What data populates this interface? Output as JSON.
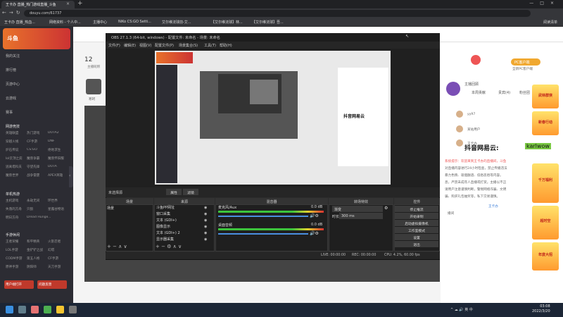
{
  "browser": {
    "tab_title": "王卡办 直播_热门游戏直播_斗鱼",
    "url": "douyu.com/61737",
    "bookmarks": [
      "王卡办 直播_热血...",
      "网络资料 - 个人中...",
      "主播中心",
      "NiKo CS:GO Setti...",
      "艾尔维法球前-艾...",
      "【艾尔维法球】林...",
      "【艾尔维法球】吾..."
    ],
    "right_label": "阅读清单"
  },
  "site": {
    "logo_text": "斗鱼",
    "header_count": "12",
    "header_count_label": "主播昵称",
    "streamer_name": "寒珂",
    "nav": [
      "我的关注",
      "排行榜",
      "页游中心",
      "云游戏",
      "赛事",
      "...",
      "..."
    ],
    "sections": [
      {
        "title": "网游竞技",
        "items": [
          "英雄联盟",
          "热门游戏",
          "DOTA2",
          "穿越火线",
          "CF手游",
          "DNF",
          "炉石传说",
          "CS:GO",
          "绝地求生",
          "lol云顶之弈",
          "魔兽争霸",
          "魔兽怀旧服",
          "逃离塔科夫",
          "守望先锋",
          "DOTA",
          "魔兽世界",
          "战争雷霆",
          "APEX英雄"
        ]
      },
      {
        "title": "单机热游",
        "items": [
          "主机游戏",
          "永劫无间",
          "环世界",
          "失落的方舟",
          "只狼",
          "星露谷物语",
          "明日方舟",
          "Dread Hunger",
          "..."
        ]
      },
      {
        "title": "手游休闲",
        "items": [
          "王者荣耀",
          "和平精英",
          "火影忍者",
          "LOL手游",
          "金铲铲之战",
          "幻塔",
          "CODM手游",
          "第五人格",
          "CF手游",
          "原神手游",
          "阴阳师",
          "天刀手游"
        ]
      }
    ],
    "sidebar_btn1": "用户端打开",
    "sidebar_btn2": "问题反馈"
  },
  "obs": {
    "title": "OBS 27.1.3 (64-bit, windows) - 配置文件: 未命名 - 场景: 未命名",
    "menu": [
      "文件(F)",
      "编辑(E)",
      "视图(V)",
      "配置文件(P)",
      "场景集合(S)",
      "工具(T)",
      "帮助(H)"
    ],
    "source_selected": "未选择源",
    "mode_btns": [
      "属性",
      "滤镜"
    ],
    "docks": {
      "scenes": "场景",
      "sources": "来源",
      "mixer": "混音器",
      "transitions": "转场特效",
      "controls": "控件"
    },
    "scene_items": [
      "场景"
    ],
    "source_items": [
      "斗鱼PP网址",
      "窗口采集",
      "文本 (GDI+)",
      "图像显示",
      "文本 (GDI+) 2",
      "显示器采集"
    ],
    "mixer": [
      {
        "name": "麦克风/Aux",
        "db": "0.0 dB"
      },
      {
        "name": "桌面音频",
        "db": "0.0 dB"
      }
    ],
    "transition": {
      "type": "渐变",
      "duration_label": "时长",
      "duration": "300 ms"
    },
    "controls": [
      "停止推流",
      "开始录制",
      "启动虚拟摄像机",
      "工作室模式",
      "设置",
      "退出"
    ],
    "status": {
      "live": "LIVE: 00:00:00",
      "rec": "REC: 00:00:00",
      "cpu": "CPU: 4.2%, 60.00 fps"
    }
  },
  "watermark": {
    "preview": "抖音网易云",
    "overlay": "抖音网易云:",
    "overlay_tag": "karlwow"
  },
  "right": {
    "pc_button": "PC客户端",
    "pc_sub": "全新PC客户端",
    "tabs": [
      "主播回顾",
      "本周贡献",
      "贵宾(4)",
      "粉丝团"
    ],
    "ranks": [
      "yy97",
      "某站用户",
      "王卡办"
    ],
    "chat_lines": [
      "系统提示：欢迎来到王卡办的直播间，斗鱼",
      "对直播内容进行24小时检查，禁止传播违法",
      "暴力色情、吸烟酗酒、低俗恶俗等内容。",
      "息，严禁未成年人直播或打赏。主播以不正",
      "请用户注意谨慎判断，警惕网络诈骗、文明",
      "骗、购买礼包抽奖等，私下交易谨慎。"
    ],
    "user_line": "王卡办",
    "user_msg": "播间",
    "ads": [
      "武林群侠",
      "新春行动",
      "千万福利",
      "超时空",
      "年度大招"
    ]
  },
  "taskbar": {
    "time": "03:08",
    "date": "2022/3/20",
    "lang": "英",
    "tray": "中"
  },
  "colors": {
    "accent": "#f0a830",
    "brand": "#e8722b",
    "danger": "#c0392b",
    "obs_bg": "#2b2b2b"
  }
}
